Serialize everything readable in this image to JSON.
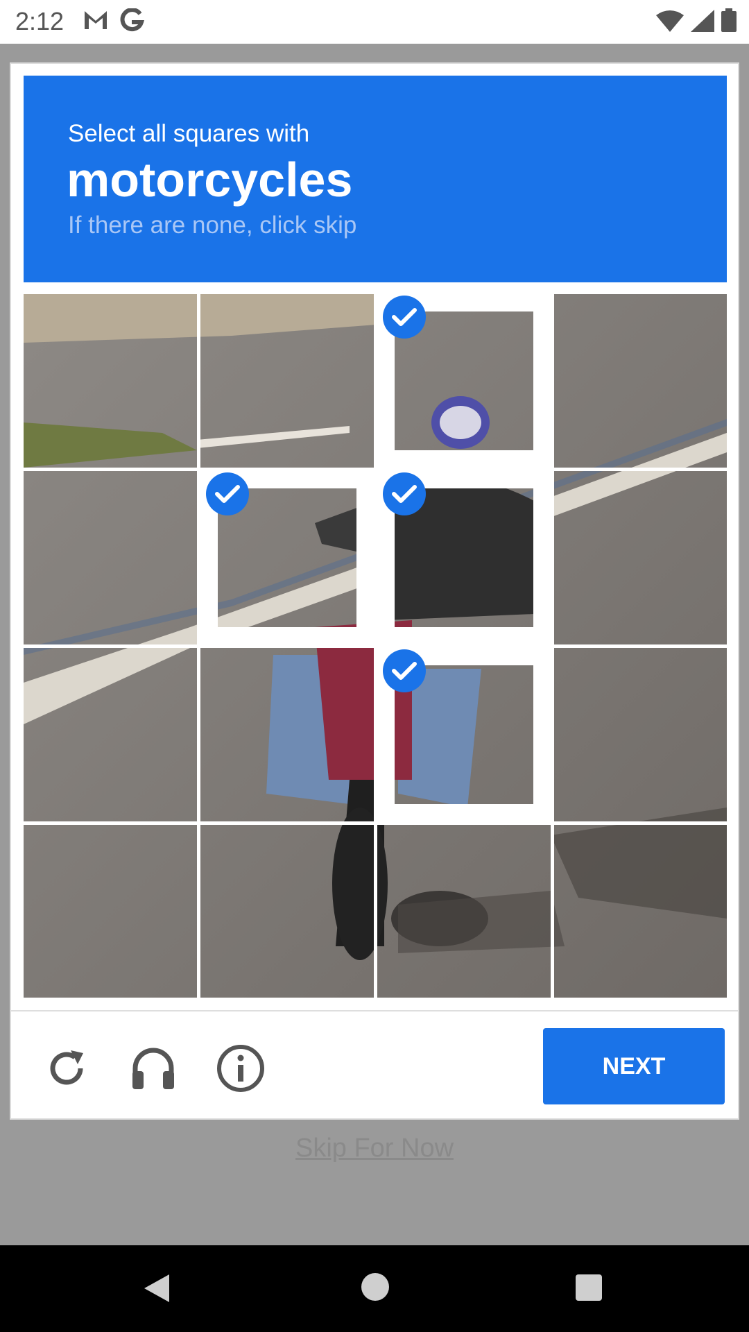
{
  "status_bar": {
    "time": "2:12",
    "icons": [
      "gmail-icon",
      "google-icon",
      "wifi-icon",
      "signal-icon",
      "battery-icon"
    ]
  },
  "captcha": {
    "prompt": "Select all squares with",
    "target": "motorcycles",
    "hint": "If there are none, click skip",
    "accent_color": "#1a73e8",
    "tiles": [
      {
        "row": 1,
        "col": 1,
        "selected": false
      },
      {
        "row": 1,
        "col": 2,
        "selected": false
      },
      {
        "row": 1,
        "col": 3,
        "selected": true
      },
      {
        "row": 1,
        "col": 4,
        "selected": false
      },
      {
        "row": 2,
        "col": 1,
        "selected": false
      },
      {
        "row": 2,
        "col": 2,
        "selected": true
      },
      {
        "row": 2,
        "col": 3,
        "selected": true
      },
      {
        "row": 2,
        "col": 4,
        "selected": false
      },
      {
        "row": 3,
        "col": 1,
        "selected": false
      },
      {
        "row": 3,
        "col": 2,
        "selected": false
      },
      {
        "row": 3,
        "col": 3,
        "selected": true
      },
      {
        "row": 3,
        "col": 4,
        "selected": false
      },
      {
        "row": 4,
        "col": 1,
        "selected": false
      },
      {
        "row": 4,
        "col": 2,
        "selected": false
      },
      {
        "row": 4,
        "col": 3,
        "selected": false
      },
      {
        "row": 4,
        "col": 4,
        "selected": false
      }
    ],
    "footer": {
      "reload_icon": "reload-icon",
      "audio_icon": "headphones-icon",
      "info_icon": "info-icon",
      "next_label": "NEXT"
    }
  },
  "skip_link": "Skip For Now",
  "nav_bar": {
    "icons": [
      "back-icon",
      "home-icon",
      "recents-icon"
    ]
  }
}
